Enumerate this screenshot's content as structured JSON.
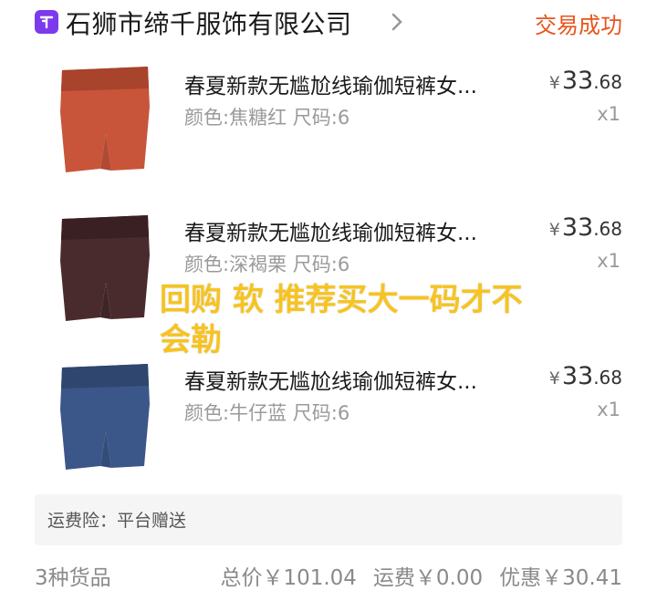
{
  "header": {
    "shop_name": "石狮市缔千服饰有限公司",
    "status": "交易成功",
    "accent_color": "#e8541c",
    "shop_icon_color": "#7c3aed"
  },
  "items": [
    {
      "title": "春夏新款无尴尬线瑜伽短裤女...",
      "spec": "颜色:焦糖红 尺码:6",
      "currency": "¥",
      "price_int": "33",
      "price_dec": ".68",
      "qty": "x1",
      "color": "#c8553a"
    },
    {
      "title": "春夏新款无尴尬线瑜伽短裤女...",
      "spec": "颜色:深褐栗 尺码:6",
      "currency": "¥",
      "price_int": "33",
      "price_dec": ".68",
      "qty": "x1",
      "color": "#4a2b2d"
    },
    {
      "title": "春夏新款无尴尬线瑜伽短裤女...",
      "spec": "颜色:牛仔蓝 尺码:6",
      "currency": "¥",
      "price_int": "33",
      "price_dec": ".68",
      "qty": "x1",
      "color": "#3b5688"
    }
  ],
  "overlay_text": "回购 软 推荐买大一码才不会勒",
  "insurance": "运费险：平台赠送",
  "summary": {
    "count": "3种货品",
    "total": "总价￥101.04",
    "shipping": "运费￥0.00",
    "discount": "优惠￥30.41"
  }
}
